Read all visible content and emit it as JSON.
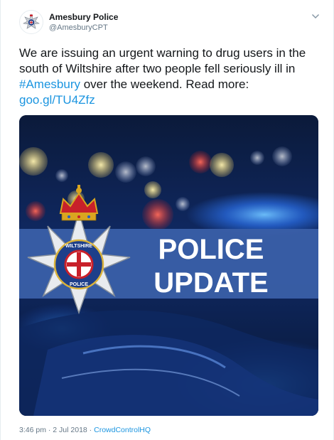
{
  "author": {
    "display_name": "Amesbury Police",
    "handle": "@AmesburyCPT"
  },
  "tweet": {
    "text_part1": "We are issuing an urgent warning to drug users in the south of Wiltshire after two people fell seriously ill in ",
    "hashtag": "#Amesbury",
    "text_part2": " over the weekend. Read more: ",
    "link": "goo.gl/TU4Zfz"
  },
  "media": {
    "headline_line1": "POLICE",
    "headline_line2": "UPDATE",
    "badge_top_text": "WILTSHIRE",
    "badge_bottom_text": "POLICE",
    "colors": {
      "banner": "#3a5fa8",
      "background_dark": "#0a1a3d",
      "light_blue": "#2f7bff"
    }
  },
  "meta": {
    "time": "3:46 pm",
    "date": "2 Jul 2018",
    "separator": " · ",
    "source": "CrowdControlHQ"
  },
  "icons": {
    "avatar": "police-star-icon",
    "caret": "chevron-down-icon"
  }
}
